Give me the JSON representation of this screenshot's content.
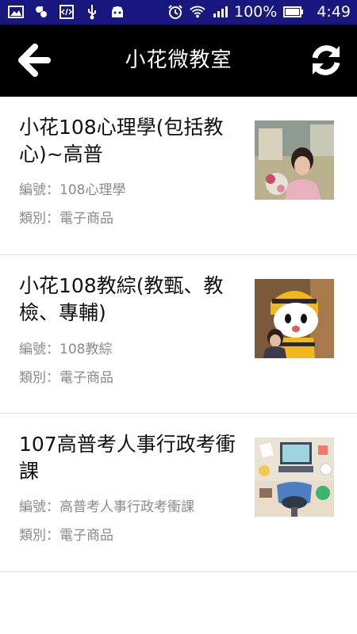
{
  "status_bar": {
    "battery": "100%",
    "time": "4:49",
    "icons": [
      "gallery-icon",
      "tools-icon",
      "code-icon",
      "usb-icon",
      "android-icon",
      "alarm-icon",
      "wifi-icon",
      "signal-icon",
      "battery-icon"
    ],
    "background": "#17177f"
  },
  "app_bar": {
    "title": "小花微教室",
    "back_icon": "arrow-left-icon",
    "refresh_icon": "refresh-icon",
    "background": "#000000"
  },
  "products": [
    {
      "title": "小花108心理學(包括教心)~高普",
      "code_label": "編號：",
      "code": "108心理學",
      "category_label": "類別：",
      "category": "電子商品",
      "thumbnail": "woman-with-flowers-photo"
    },
    {
      "title": "小花108教綜(教甄、教檢、專輔)",
      "code_label": "編號：",
      "code": "108教綜",
      "category_label": "類別：",
      "category": "電子商品",
      "thumbnail": "woman-with-mascot-photo"
    },
    {
      "title": "107高普考人事行政考衝課",
      "code_label": "編號：",
      "code": "高普考人事行政考衝課",
      "category_label": "類別：",
      "category": "電子商品",
      "thumbnail": "desk-illustration"
    }
  ]
}
